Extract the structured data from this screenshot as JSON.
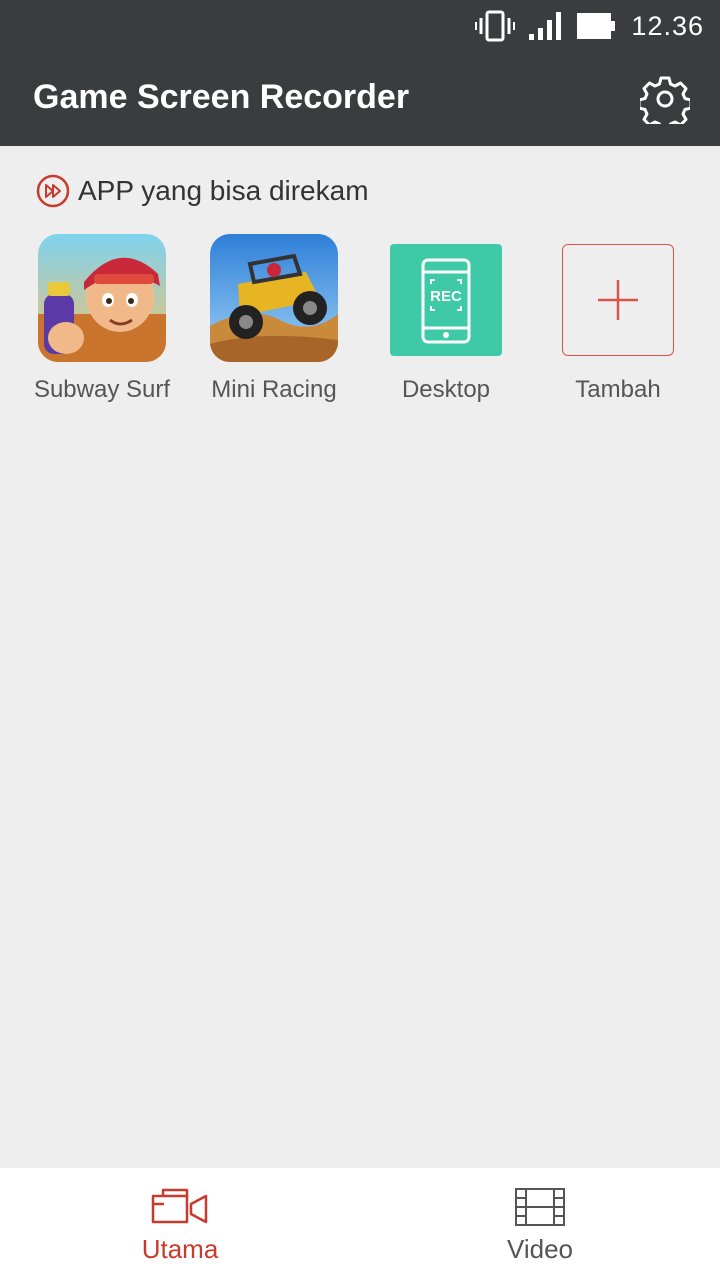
{
  "status_bar": {
    "time": "12.36",
    "icons": [
      "vibrate-icon",
      "signal-icon",
      "battery-icon"
    ]
  },
  "app_bar": {
    "title": "Game Screen Recorder",
    "settings_icon": "gear-icon"
  },
  "section": {
    "title": "APP yang bisa direkam",
    "icon": "fast-forward-circle-icon"
  },
  "apps": [
    {
      "label": "Subway Surf",
      "icon": "subway-surf-icon"
    },
    {
      "label": "Mini Racing",
      "icon": "mini-racing-icon"
    },
    {
      "label": "Desktop",
      "icon": "rec-phone-icon",
      "icon_text": "REC"
    },
    {
      "label": "Tambah",
      "icon": "plus-icon"
    }
  ],
  "bottom_nav": {
    "tabs": [
      {
        "label": "Utama",
        "icon": "recorder-icon",
        "active": true
      },
      {
        "label": "Video",
        "icon": "film-icon",
        "active": false
      }
    ]
  },
  "colors": {
    "accent": "#c73a2c",
    "appbar": "#3b3c40",
    "background": "#eeeeee",
    "desktop_tile": "#3ec9a7"
  }
}
